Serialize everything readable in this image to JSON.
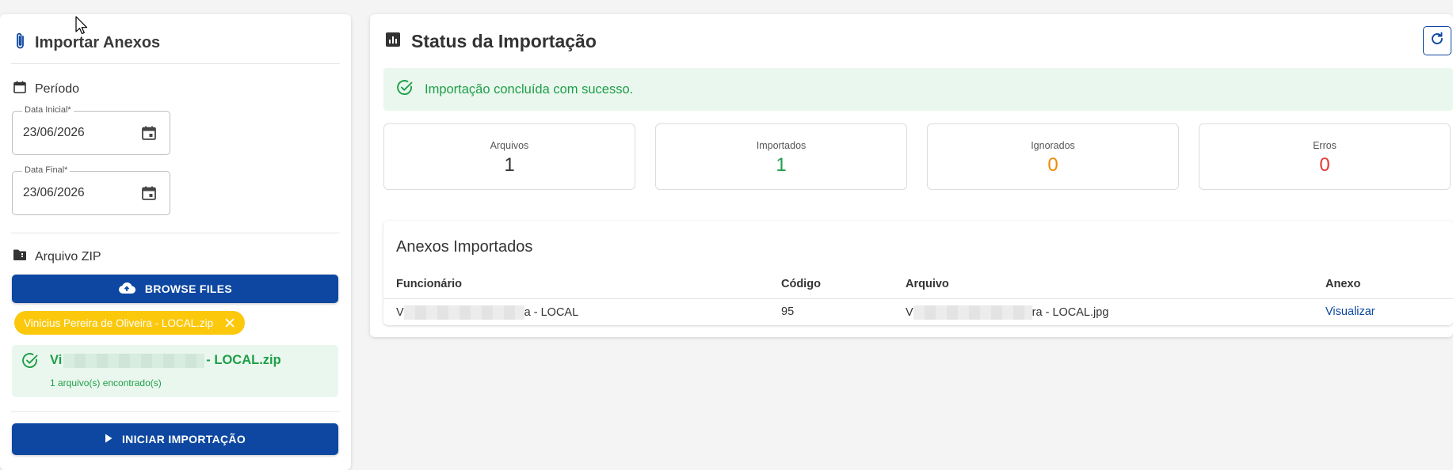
{
  "left": {
    "title": "Importar Anexos",
    "periodo": {
      "heading": "Período",
      "data_inicial_label": "Data Inicial*",
      "data_inicial_value": "23/06/2026",
      "data_final_label": "Data Final*",
      "data_final_value": "23/06/2026"
    },
    "arquivo": {
      "heading": "Arquivo ZIP",
      "browse_label": "BROWSE FILES",
      "chip_label": "Vinicius Pereira de Oliveira - LOCAL.zip",
      "found_name_start": "Vi",
      "found_name_end": "- LOCAL.zip",
      "found_count": "1 arquivo(s) encontrado(s)"
    },
    "start_label": "INICIAR IMPORTAÇÃO"
  },
  "status": {
    "title": "Status da Importação",
    "success_message": "Importação concluída com sucesso.",
    "stats": [
      {
        "label": "Arquivos",
        "value": "1",
        "color": "#333333"
      },
      {
        "label": "Importados",
        "value": "1",
        "color": "#1e9e48"
      },
      {
        "label": "Ignorados",
        "value": "0",
        "color": "#f08c00"
      },
      {
        "label": "Erros",
        "value": "0",
        "color": "#e53935"
      }
    ]
  },
  "table": {
    "title": "Anexos Importados",
    "headers": [
      "Funcionário",
      "Código",
      "Arquivo",
      "Anexo"
    ],
    "rows": [
      {
        "funcionario_start": "V",
        "funcionario_end": "a - LOCAL",
        "codigo": "95",
        "arquivo_start": "V",
        "arquivo_end": "ra - LOCAL.jpg",
        "anexo": "Visualizar"
      }
    ]
  },
  "colors": {
    "primary": "#0d47a1",
    "success": "#1e9e48",
    "success_bg": "#eaf7ee",
    "chip": "#fbc80c",
    "warning": "#f08c00",
    "error": "#e53935"
  },
  "icons": {
    "left_title": "paperclip-icon",
    "periodo": "calendar-icon",
    "date_picker": "calendar-event-icon",
    "arquivo": "folder-zip-icon",
    "browse": "cloud-upload-icon",
    "chip_remove": "close-icon",
    "file_ok": "check-circle-icon",
    "start": "play-icon",
    "status": "bar-chart-icon",
    "refresh": "refresh-icon",
    "alert": "check-circle-icon"
  }
}
